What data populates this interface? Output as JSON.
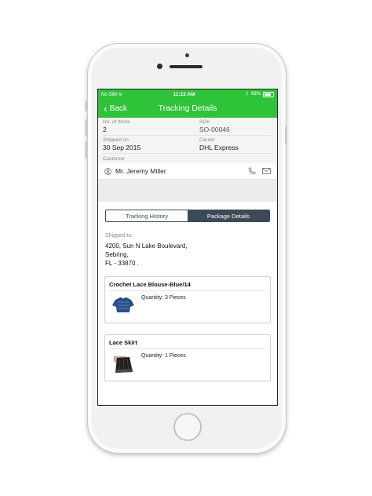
{
  "status_bar": {
    "carrier": "No SIM",
    "time": "11:22 AM",
    "battery": "93%"
  },
  "navbar": {
    "back_label": "Back",
    "title": "Tracking Details"
  },
  "info": {
    "items_label": "No. of Items",
    "items_value": "2",
    "so_label": "SO#",
    "so_value": "SO-00046",
    "shipped_label": "Shipped on",
    "shipped_value": "30 Sep 2015",
    "carrier_label": "Carrier",
    "carrier_value": "DHL Express",
    "customer_label": "Customer",
    "customer_name": "Mr. Jeremy Miller"
  },
  "tabs": [
    {
      "label": "Tracking History",
      "active": false
    },
    {
      "label": "Package Details",
      "active": true
    }
  ],
  "shipping": {
    "label": "Shipped to:",
    "line1": "4200, Sun N Lake Boulevard,",
    "line2": "Sebring,",
    "line3": "FL  - 33870 ."
  },
  "products": [
    {
      "name": "Crochet Lace Blouse-Blue/14",
      "quantity": "Quantity: 3 Pieces",
      "thumb_icon": "blue-blouse-image"
    },
    {
      "name": "Lace Skirt",
      "quantity": "Quantity: 1 Pieces",
      "thumb_icon": "lace-skirt-image"
    }
  ],
  "colors": {
    "accent": "#2fc33a",
    "segment": "#3d4a56"
  }
}
